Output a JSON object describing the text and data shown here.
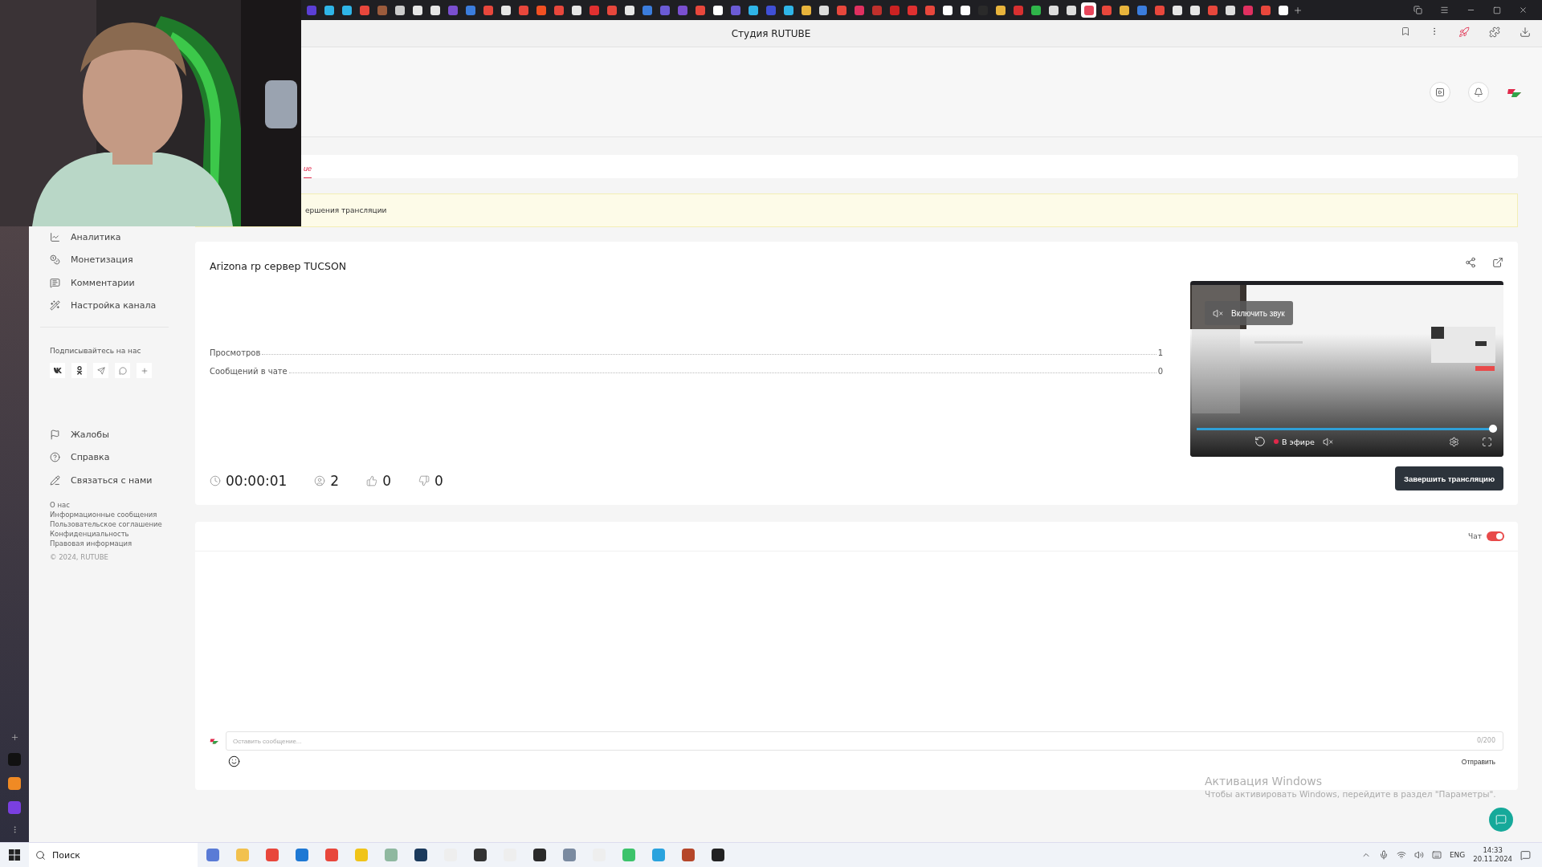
{
  "browser": {
    "tabs": [
      {
        "color": "#5b3fd6",
        "selected": false
      },
      {
        "color": "#2fb5e8",
        "selected": false
      },
      {
        "color": "#2fb5e8",
        "selected": false
      },
      {
        "color": "#e8473c",
        "selected": false
      },
      {
        "color": "#9b5b3c",
        "selected": false
      },
      {
        "color": "#cccccc",
        "selected": false
      },
      {
        "color": "#e6e6e6",
        "selected": false
      },
      {
        "color": "#e6e6e6",
        "selected": false
      },
      {
        "color": "#7a4fd0",
        "selected": false
      },
      {
        "color": "#3b7ddd",
        "selected": false
      },
      {
        "color": "#e8473c",
        "selected": false
      },
      {
        "color": "#e6e6e6",
        "selected": false
      },
      {
        "color": "#e8473c",
        "selected": false
      },
      {
        "color": "#f25022",
        "selected": false
      },
      {
        "color": "#e8473c",
        "selected": false
      },
      {
        "color": "#e6e6e6",
        "selected": false
      },
      {
        "color": "#e03030",
        "selected": false
      },
      {
        "color": "#e8473c",
        "selected": false
      },
      {
        "color": "#e6e6e6",
        "selected": false
      },
      {
        "color": "#3b7ddd",
        "selected": false
      },
      {
        "color": "#6b5bd6",
        "selected": false
      },
      {
        "color": "#7a4fd0",
        "selected": false
      },
      {
        "color": "#e8473c",
        "selected": false
      },
      {
        "color": "#ffffff",
        "selected": false
      },
      {
        "color": "#6b5bd6",
        "selected": false
      },
      {
        "color": "#2fb5e8",
        "selected": false
      },
      {
        "color": "#3f4fd6",
        "selected": false
      },
      {
        "color": "#2fb5e8",
        "selected": false
      },
      {
        "color": "#e8b43c",
        "selected": false
      },
      {
        "color": "#dddddd",
        "selected": false
      },
      {
        "color": "#e8473c",
        "selected": false
      },
      {
        "color": "#e03060",
        "selected": false
      },
      {
        "color": "#c0302c",
        "selected": false
      },
      {
        "color": "#cc2222",
        "selected": false
      },
      {
        "color": "#e03030",
        "selected": false
      },
      {
        "color": "#e8473c",
        "selected": false
      },
      {
        "color": "#ffffff",
        "selected": false
      },
      {
        "color": "#ffffff",
        "selected": false
      },
      {
        "color": "#2a2a2a",
        "selected": false
      },
      {
        "color": "#e8b43c",
        "selected": false
      },
      {
        "color": "#d83030",
        "selected": false
      },
      {
        "color": "#2fb54a",
        "selected": false
      },
      {
        "color": "#dddddd",
        "selected": false
      },
      {
        "color": "#dddddd",
        "selected": false
      },
      {
        "color": "#e8475c",
        "selected": true
      },
      {
        "color": "#e8473c",
        "selected": false
      },
      {
        "color": "#e8b43c",
        "selected": false
      },
      {
        "color": "#3b7ddd",
        "selected": false
      },
      {
        "color": "#e8473c",
        "selected": false
      },
      {
        "color": "#e6e6e6",
        "selected": false
      },
      {
        "color": "#e6e6e6",
        "selected": false
      },
      {
        "color": "#e8473c",
        "selected": false
      },
      {
        "color": "#dddddd",
        "selected": false
      },
      {
        "color": "#e03060",
        "selected": false
      },
      {
        "color": "#e8473c",
        "selected": false
      },
      {
        "color": "#ffffff",
        "selected": false
      }
    ],
    "title": "Студия RUTUBE"
  },
  "sidebar": {
    "items": [
      {
        "label": "Аналитика",
        "kind": "chart"
      },
      {
        "label": "Монетизация",
        "kind": "coin"
      },
      {
        "label": "Комментарии",
        "kind": "comments"
      },
      {
        "label": "Настройка канала",
        "kind": "wand"
      }
    ],
    "social_heading": "Подписывайтесь на нас",
    "social": [
      {
        "kind": "vk"
      },
      {
        "kind": "ok"
      },
      {
        "kind": "telegram"
      },
      {
        "kind": "viber"
      },
      {
        "kind": "more"
      }
    ],
    "support": [
      {
        "label": "Жалобы",
        "kind": "flag"
      },
      {
        "label": "Справка",
        "kind": "help"
      },
      {
        "label": "Связаться с нами",
        "kind": "pen"
      }
    ],
    "footer_links": [
      "О нас",
      "Информационные сообщения",
      "Пользовательское соглашение",
      "Конфиденциальность",
      "Правовая информация"
    ],
    "copyright": "© 2024, RUTUBE"
  },
  "tabs": [
    {
      "label": "ие",
      "selected": true
    }
  ],
  "notice": "ершения трансляции",
  "stream": {
    "title": "Arizona rp сервер TUCSON",
    "stats": [
      {
        "label": "Просмотров",
        "value": "1"
      },
      {
        "label": "Сообщений в чате",
        "value": "0"
      }
    ],
    "counters": [
      {
        "kind": "time",
        "value": "00:00:01"
      },
      {
        "kind": "viewers",
        "value": "2"
      },
      {
        "kind": "likes",
        "value": "0"
      },
      {
        "kind": "dislikes",
        "value": "0"
      }
    ],
    "player": {
      "unmute": "Включить звук",
      "live": "В эфире",
      "level": 1
    },
    "end_button": "Завершить трансляцию"
  },
  "chat": {
    "label": "Чат",
    "on": true,
    "placeholder": "Оставить сообщение...",
    "counter": "0/200",
    "send": "Отправить"
  },
  "windows_activation": {
    "title": "Активация Windows",
    "text": "Чтобы активировать Windows, перейдите в раздел \"Параметры\"."
  },
  "taskbar": {
    "search": "Поиск",
    "apps": [
      {
        "color": "#5a7bd6"
      },
      {
        "color": "#f2c14e"
      },
      {
        "color": "#e8473c"
      },
      {
        "color": "#1e78d4"
      },
      {
        "color": "#e8473c"
      },
      {
        "color": "#f0c419"
      },
      {
        "color": "#8fb8a0"
      },
      {
        "color": "#1b3a5c"
      },
      {
        "color": "#eeeeee"
      },
      {
        "color": "#333333"
      },
      {
        "color": "#eeeeee"
      },
      {
        "color": "#2a2a2a"
      },
      {
        "color": "#7a8aa0"
      },
      {
        "color": "#eeeeee"
      },
      {
        "color": "#3cc36b"
      },
      {
        "color": "#2aa3de"
      },
      {
        "color": "#b5462a"
      },
      {
        "color": "#222222"
      }
    ],
    "lang": "ENG",
    "time": "14:33",
    "date": "20.11.2024"
  }
}
